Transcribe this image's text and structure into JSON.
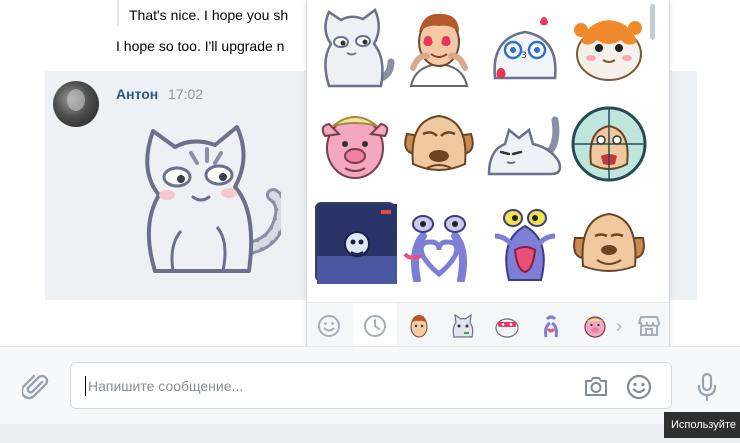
{
  "history": {
    "quoted_text": "That's nice. I hope you sh",
    "message_text": "I hope so too. I'll upgrade n",
    "author": "Антон",
    "time": "17:02"
  },
  "sticker_panel": {
    "stickers": [
      {
        "name": "sticker-gray-cat-smirk"
      },
      {
        "name": "sticker-boy-heart-eyes"
      },
      {
        "name": "sticker-seal-kiss"
      },
      {
        "name": "sticker-hamster-cheeky"
      },
      {
        "name": "sticker-pig-face-hat"
      },
      {
        "name": "sticker-old-dog-grumpy"
      },
      {
        "name": "sticker-gray-cat-lying"
      },
      {
        "name": "sticker-old-dog-crosshair"
      },
      {
        "name": "sticker-pigeon-window"
      },
      {
        "name": "sticker-blue-creature-heart"
      },
      {
        "name": "sticker-blue-creature-tongue"
      },
      {
        "name": "sticker-old-dog-smile"
      }
    ],
    "tabs": [
      {
        "name": "emoji-tab-icon",
        "active": false
      },
      {
        "name": "recent-tab-icon",
        "active": true
      },
      {
        "name": "pack-boy-icon",
        "active": false
      },
      {
        "name": "pack-cat-icon",
        "active": false
      },
      {
        "name": "pack-seal-icon",
        "active": false
      },
      {
        "name": "pack-creature-icon",
        "active": false
      },
      {
        "name": "pack-pig-icon",
        "active": false
      }
    ],
    "more_arrow": "›",
    "store_icon": "sticker-store-icon"
  },
  "composer": {
    "placeholder": "Напишите сообщение...",
    "value": ""
  },
  "tooltip": {
    "text": "Используйте"
  },
  "colors": {
    "accent": "#2a5885",
    "message_bg": "#edf0f5",
    "icon_gray": "#828a99"
  }
}
